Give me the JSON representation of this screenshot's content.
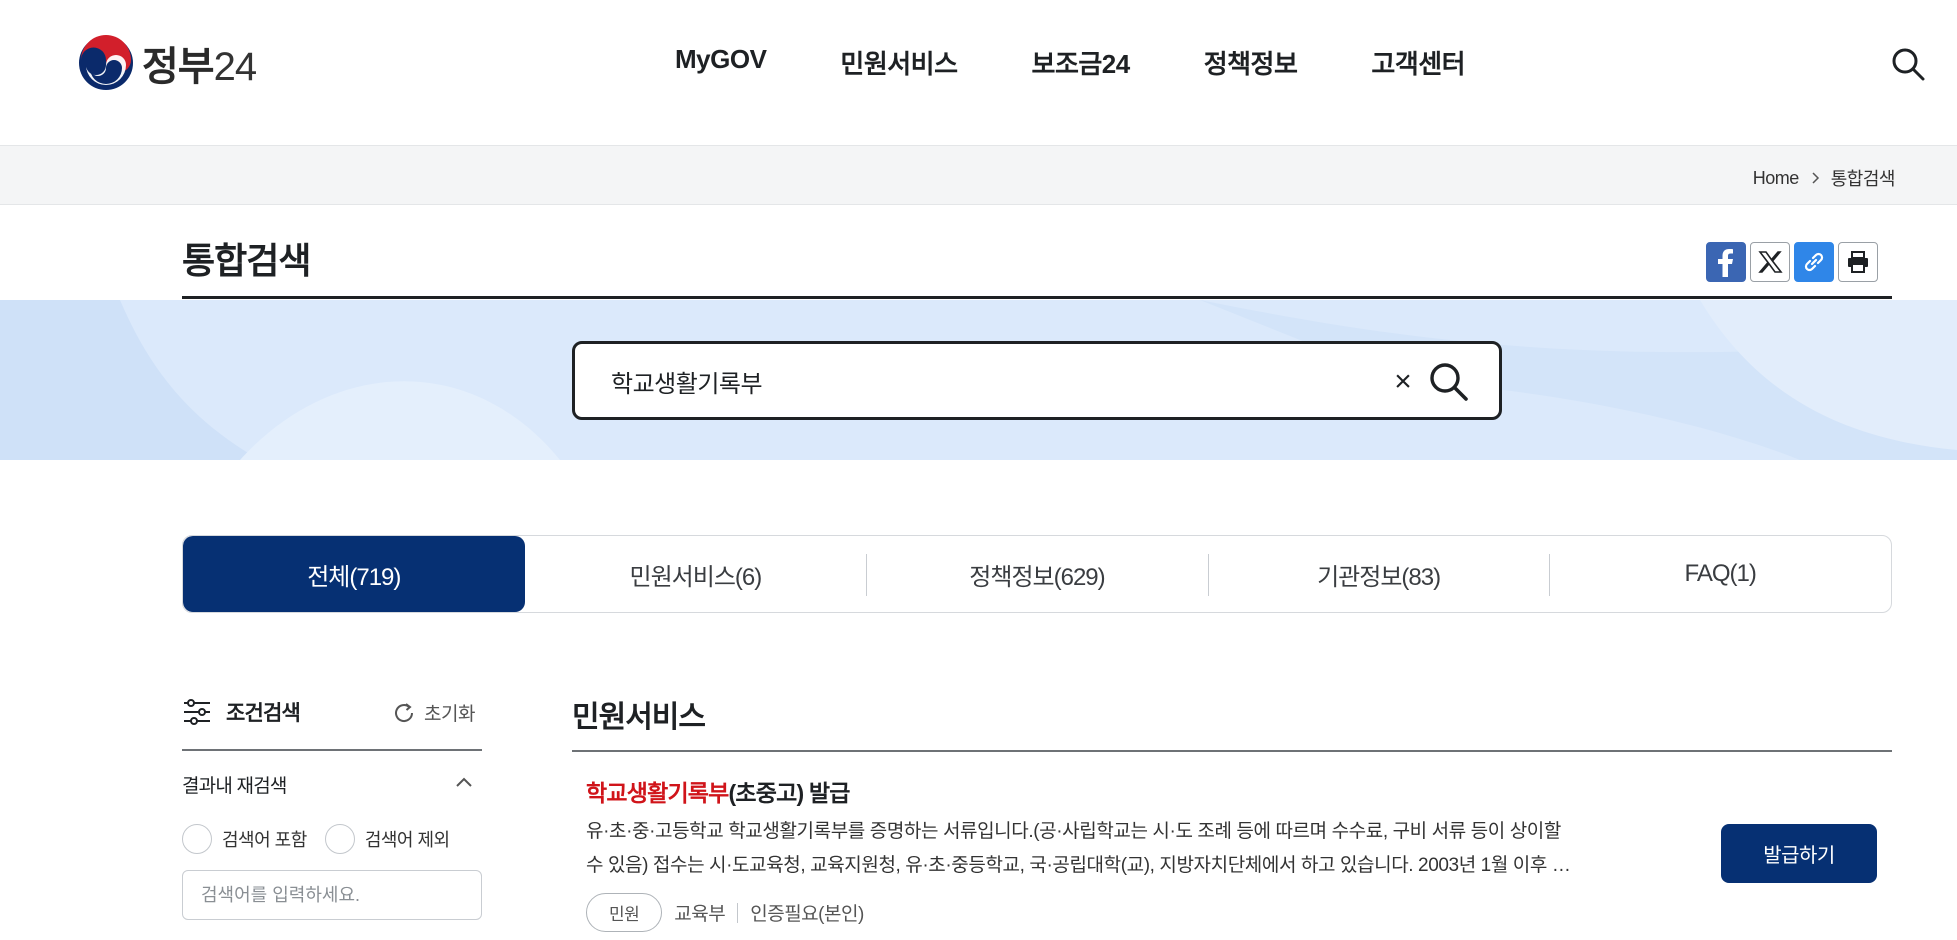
{
  "header": {
    "logo_text": "정부",
    "logo_num": "24",
    "nav": [
      {
        "label": "MyGOV"
      },
      {
        "label": "민원서비스"
      },
      {
        "label": "보조금24"
      },
      {
        "label": "정책정보"
      },
      {
        "label": "고객센터"
      }
    ],
    "search_icon": "search-icon"
  },
  "breadcrumb": {
    "home": "Home",
    "current": "통합검색"
  },
  "page": {
    "title": "통합검색",
    "share_icons": [
      "facebook-icon",
      "x-twitter-icon",
      "link-icon",
      "print-icon"
    ]
  },
  "search": {
    "value": "학교생활기록부",
    "clear_label": "×"
  },
  "tabs": [
    {
      "label": "전체(719)",
      "active": true
    },
    {
      "label": "민원서비스(6)",
      "active": false
    },
    {
      "label": "정책정보(629)",
      "active": false
    },
    {
      "label": "기관정보(83)",
      "active": false
    },
    {
      "label": "FAQ(1)",
      "active": false
    }
  ],
  "filter": {
    "title": "조건검색",
    "reset": "초기화",
    "refine_title": "결과내 재검색",
    "include": "검색어 포함",
    "exclude": "검색어 제외",
    "placeholder": "검색어를 입력하세요."
  },
  "results": {
    "section_title": "민원서비스",
    "items": [
      {
        "title_highlight": "학교생활기록부",
        "title_rest": "(초중고) 발급",
        "desc_line1": "유·초·중·고등학교 학교생활기록부를 증명하는 서류입니다.(공·사립학교는 시·도 조례 등에 따르며 수수료, 구비 서류 등이 상이할",
        "desc_line2": "수 있음) 접수는 시·도교육청, 교육지원청, 유·초·중등학교, 국·공립대학(교), 지방자치단체에서 하고 있습니다. 2003년 1월 이후 …",
        "chip": "민원",
        "agency": "교육부",
        "auth": "인증필요(본인)",
        "button": "발급하기"
      }
    ]
  },
  "colors": {
    "primary": "#063073",
    "highlight": "#d0141a",
    "hero_bg": "#dbe9fb"
  }
}
